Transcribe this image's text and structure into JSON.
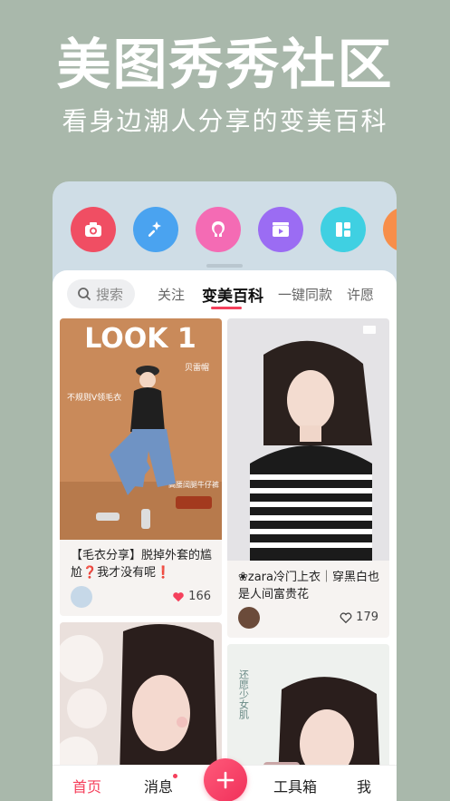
{
  "promo": {
    "headline": "美图秀秀社区",
    "subline": "看身边潮人分享的变美百科"
  },
  "colors": {
    "accent": "#f5405c",
    "background": "#a9b8ab"
  },
  "tool_icons": [
    {
      "icon": "camera-icon",
      "color": "#f04e63"
    },
    {
      "icon": "magic-wand-icon",
      "color": "#4aa3f0"
    },
    {
      "icon": "hair-icon",
      "color": "#f46bb4"
    },
    {
      "icon": "video-clapper-icon",
      "color": "#9b6cf3"
    },
    {
      "icon": "collage-grid-icon",
      "color": "#3fd0e2"
    },
    {
      "icon": "more-tool-icon",
      "color": "#f78e4a"
    }
  ],
  "search": {
    "placeholder": "搜索"
  },
  "tabs": [
    {
      "label": "关注"
    },
    {
      "label": "变美百科"
    },
    {
      "label": "一键同款"
    },
    {
      "label": "许愿"
    }
  ],
  "feed": {
    "cards": [
      {
        "poster_text": "LOOK 1",
        "annotations": [
          "贝雷帽",
          "不规则V领毛衣",
          "高腰阔腿牛仔裤"
        ],
        "title": "【毛衣分享】脱掉外套的尴尬❓我才没有呢❗",
        "likes": "166"
      },
      {
        "title": "❀zara冷门上衣｜穿黑白也是人间富贵花",
        "likes": "179"
      },
      {
        "title": ""
      },
      {
        "poster_text": "还愿少女肌"
      }
    ]
  },
  "bottom_nav": {
    "home": "首页",
    "messages": "消息",
    "tools": "工具箱",
    "me": "我"
  }
}
